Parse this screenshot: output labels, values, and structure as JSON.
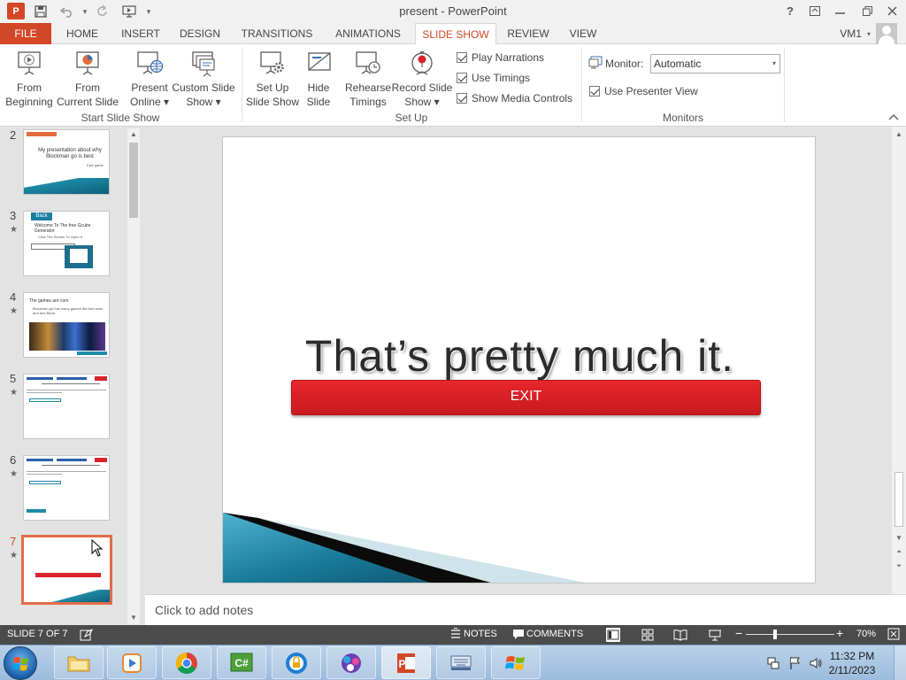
{
  "window": {
    "app_icon": "P",
    "title": "present - PowerPoint",
    "controls": [
      "?",
      "ribbon-display",
      "minimize",
      "restore",
      "close"
    ]
  },
  "tabs": {
    "file": "FILE",
    "items": [
      "HOME",
      "INSERT",
      "DESIGN",
      "TRANSITIONS",
      "ANIMATIONS",
      "SLIDE SHOW",
      "REVIEW",
      "VIEW"
    ],
    "active": "SLIDE SHOW",
    "account": "VM1"
  },
  "ribbon": {
    "start_group": {
      "label": "Start Slide Show",
      "from_beginning": [
        "From",
        "Beginning"
      ],
      "from_current": [
        "From",
        "Current Slide"
      ],
      "present_online": [
        "Present",
        "Online ▾"
      ],
      "custom_show": [
        "Custom Slide",
        "Show ▾"
      ]
    },
    "setup_group": {
      "label": "Set Up",
      "setup": [
        "Set Up",
        "Slide Show"
      ],
      "hide": [
        "Hide",
        "Slide"
      ],
      "rehearse": [
        "Rehearse",
        "Timings"
      ],
      "record": [
        "Record Slide",
        "Show ▾"
      ],
      "play_narrations": "Play Narrations",
      "use_timings": "Use Timings",
      "show_media_controls": "Show Media Controls"
    },
    "monitors_group": {
      "label": "Monitors",
      "monitor_label": "Monitor:",
      "monitor_value": "Automatic",
      "presenter_view": "Use Presenter View"
    }
  },
  "thumbnails": [
    {
      "num": "2",
      "star": false,
      "title": "My presentation about why Blockman go is best",
      "sub": "Epic game"
    },
    {
      "num": "3",
      "star": true,
      "badge": "Back",
      "title": "Welcome To The free Gcube Generator",
      "sub": "Click The Screen To Open It"
    },
    {
      "num": "4",
      "star": true,
      "title": "The games are com",
      "sub": "Blockman go has many games like bed wars and bed Block"
    },
    {
      "num": "5",
      "star": true
    },
    {
      "num": "6",
      "star": true
    },
    {
      "num": "7",
      "star": true,
      "selected": true
    }
  ],
  "slide": {
    "title": "That’s pretty much it.",
    "button": "EXIT"
  },
  "notes_placeholder": "Click to add notes",
  "status": {
    "slide_info": "SLIDE 7 OF 7",
    "notes": "NOTES",
    "comments": "COMMENTS",
    "zoom": "70%"
  },
  "tray": {
    "time": "11:32 PM",
    "date": "2/11/2023"
  },
  "colors": {
    "accent": "#d24726",
    "exit_button": "#d9232a",
    "status_bar": "#4b4b4b"
  }
}
